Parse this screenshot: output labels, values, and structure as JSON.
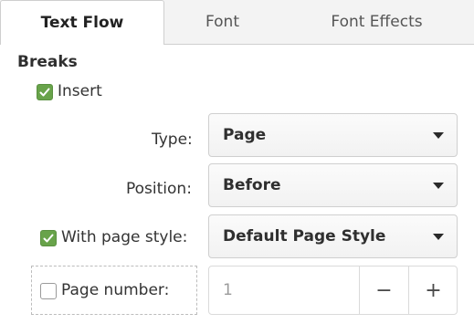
{
  "tabs": [
    {
      "label": "Text Flow",
      "active": true
    },
    {
      "label": "Font",
      "active": false
    },
    {
      "label": "Font Effects",
      "active": false
    }
  ],
  "breaks": {
    "title": "Breaks",
    "insert": {
      "label": "Insert",
      "checked": true
    },
    "type": {
      "label": "Type:",
      "value": "Page"
    },
    "position": {
      "label": "Position:",
      "value": "Before"
    },
    "with_page_style": {
      "label": "With page style:",
      "checked": true,
      "value": "Default Page Style"
    },
    "page_number": {
      "label": "Page number:",
      "checked": false,
      "value": "1",
      "decrement": "−",
      "increment": "+"
    }
  },
  "colors": {
    "check_green": "#68a34a"
  },
  "icons": {
    "dropdown": "chevron-down-icon",
    "check": "checkmark-icon"
  }
}
